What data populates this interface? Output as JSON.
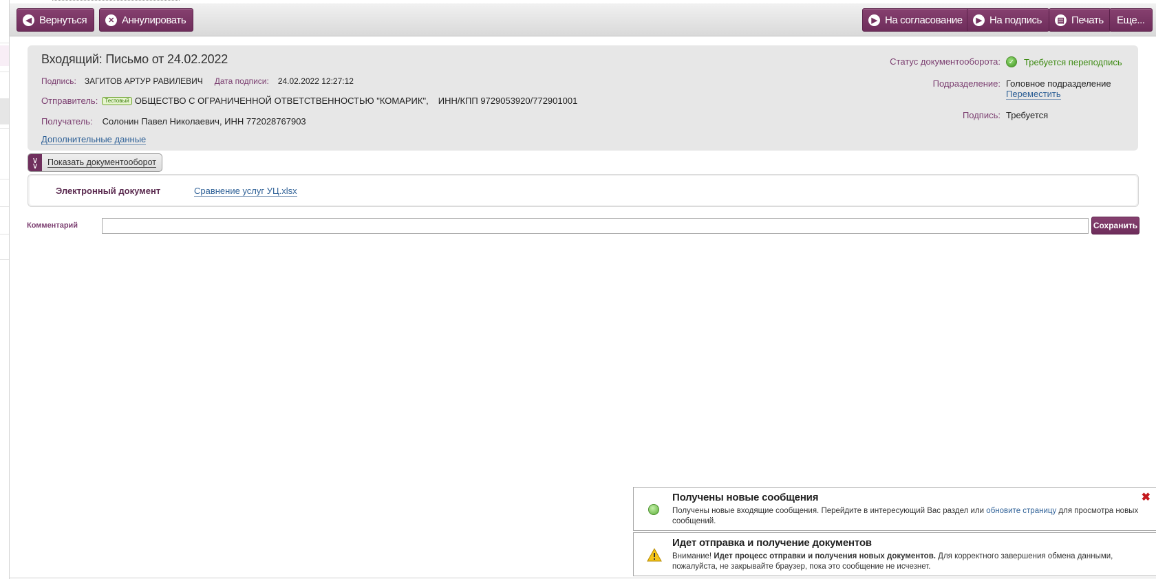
{
  "toolbar": {
    "back_label": "Вернуться",
    "annul_label": "Аннулировать",
    "approval_label": "На согласование",
    "sign_label": "На подпись",
    "print_label": "Печать",
    "more_label": "Еще..."
  },
  "document": {
    "title": "Входящий: Письмо от 24.02.2022",
    "signature_label": "Подпись:",
    "signature_value": "ЗАГИТОВ АРТУР РАВИЛЕВИЧ",
    "sign_date_label": "Дата подписи:",
    "sign_date_value": "24.02.2022 12:27:12",
    "sender_label": "Отправитель:",
    "sender_tag": "Тестовый",
    "sender_value": "ОБЩЕСТВО С ОГРАНИЧЕННОЙ ОТВЕТСТВЕННОСТЬЮ \"КОМАРИК\",",
    "sender_inn": "ИНН/КПП 9729053920/772901001",
    "recipient_label": "Получатель:",
    "recipient_value": "Солонин Павел Николаевич, ИНН 772028767903",
    "additional_data_link": "Дополнительные данные",
    "docflow_status_label": "Статус документооборота:",
    "docflow_status_value": "Требуется переподпись",
    "department_label": "Подразделение:",
    "department_value": "Головное подразделение",
    "move_link": "Переместить",
    "signature_status_label": "Подпись:",
    "signature_status_value": "Требуется",
    "status_color": "#3d8a12",
    "accent_color": "#74315f"
  },
  "docflow_toggle": {
    "label": "Показать документооборот"
  },
  "edoc": {
    "label": "Электронный документ",
    "file": "Сравнение услуг УЦ.xlsx"
  },
  "comment": {
    "label": "Комментарий",
    "value": "",
    "save_label": "Сохранить"
  },
  "notifications": [
    {
      "icon": "green-circle-icon",
      "title": "Получены новые сообщения",
      "text_before": "Получены новые входящие сообщения. Перейдите в интересующий Вас раздел или ",
      "link": "обновите страницу",
      "text_after": " для просмотра новых сообщений."
    },
    {
      "icon": "warning-icon",
      "title": "Идет отправка и получение документов",
      "text_prefix": "Внимание! ",
      "text_bold": "Идет процесс отправки и получения новых документов.",
      "text_after": " Для корректного завершения обмена данными, пожалуйста, не закрывайте браузер, пока это сообщение не исчезнет."
    }
  ]
}
